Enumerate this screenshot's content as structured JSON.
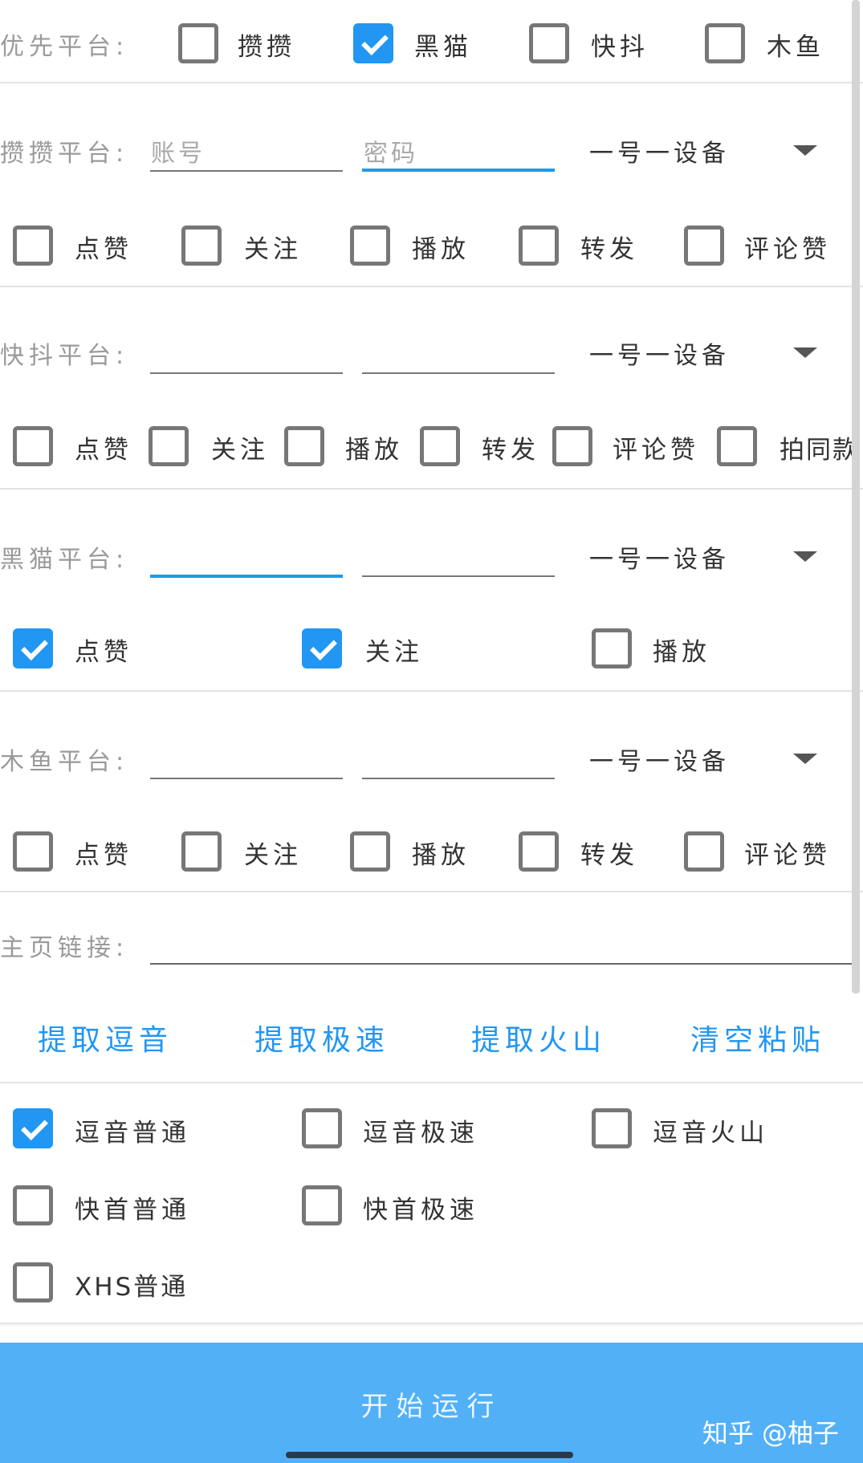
{
  "priority": {
    "label": "优先平台:",
    "options": [
      {
        "label": "攒攒",
        "checked": false
      },
      {
        "label": "黑猫",
        "checked": true
      },
      {
        "label": "快抖",
        "checked": false
      },
      {
        "label": "木鱼",
        "checked": false
      }
    ]
  },
  "zanzan": {
    "label": "攒攒平台:",
    "account_placeholder": "账号",
    "password_placeholder": "密码",
    "device": "一号一设备",
    "options": [
      {
        "label": "点赞",
        "checked": false
      },
      {
        "label": "关注",
        "checked": false
      },
      {
        "label": "播放",
        "checked": false
      },
      {
        "label": "转发",
        "checked": false
      },
      {
        "label": "评论赞",
        "checked": false
      }
    ]
  },
  "kuaidou": {
    "label": "快抖平台:",
    "device": "一号一设备",
    "options": [
      {
        "label": "点赞",
        "checked": false
      },
      {
        "label": "关注",
        "checked": false
      },
      {
        "label": "播放",
        "checked": false
      },
      {
        "label": "转发",
        "checked": false
      },
      {
        "label": "评论赞",
        "checked": false
      },
      {
        "label": "拍同款",
        "checked": false
      }
    ]
  },
  "heimao": {
    "label": "黑猫平台:",
    "device": "一号一设备",
    "options": [
      {
        "label": "点赞",
        "checked": true
      },
      {
        "label": "关注",
        "checked": true
      },
      {
        "label": "播放",
        "checked": false
      }
    ]
  },
  "muyu": {
    "label": "木鱼平台:",
    "device": "一号一设备",
    "options": [
      {
        "label": "点赞",
        "checked": false
      },
      {
        "label": "关注",
        "checked": false
      },
      {
        "label": "播放",
        "checked": false
      },
      {
        "label": "转发",
        "checked": false
      },
      {
        "label": "评论赞",
        "checked": false
      }
    ]
  },
  "homepage": {
    "label": "主页链接:",
    "value": ""
  },
  "actions": [
    "提取逗音",
    "提取极速",
    "提取火山",
    "清空粘贴"
  ],
  "modes": [
    {
      "label": "逗音普通",
      "checked": true
    },
    {
      "label": "逗音极速",
      "checked": false
    },
    {
      "label": "逗音火山",
      "checked": false
    },
    {
      "label": "快首普通",
      "checked": false
    },
    {
      "label": "快首极速",
      "checked": false
    },
    {
      "label": "XHS普通",
      "checked": false
    }
  ],
  "start_button": "开始运行",
  "watermark": "知乎 @柚子",
  "colors": {
    "accent": "#2196f3",
    "button_bg": "#52b0f7"
  }
}
